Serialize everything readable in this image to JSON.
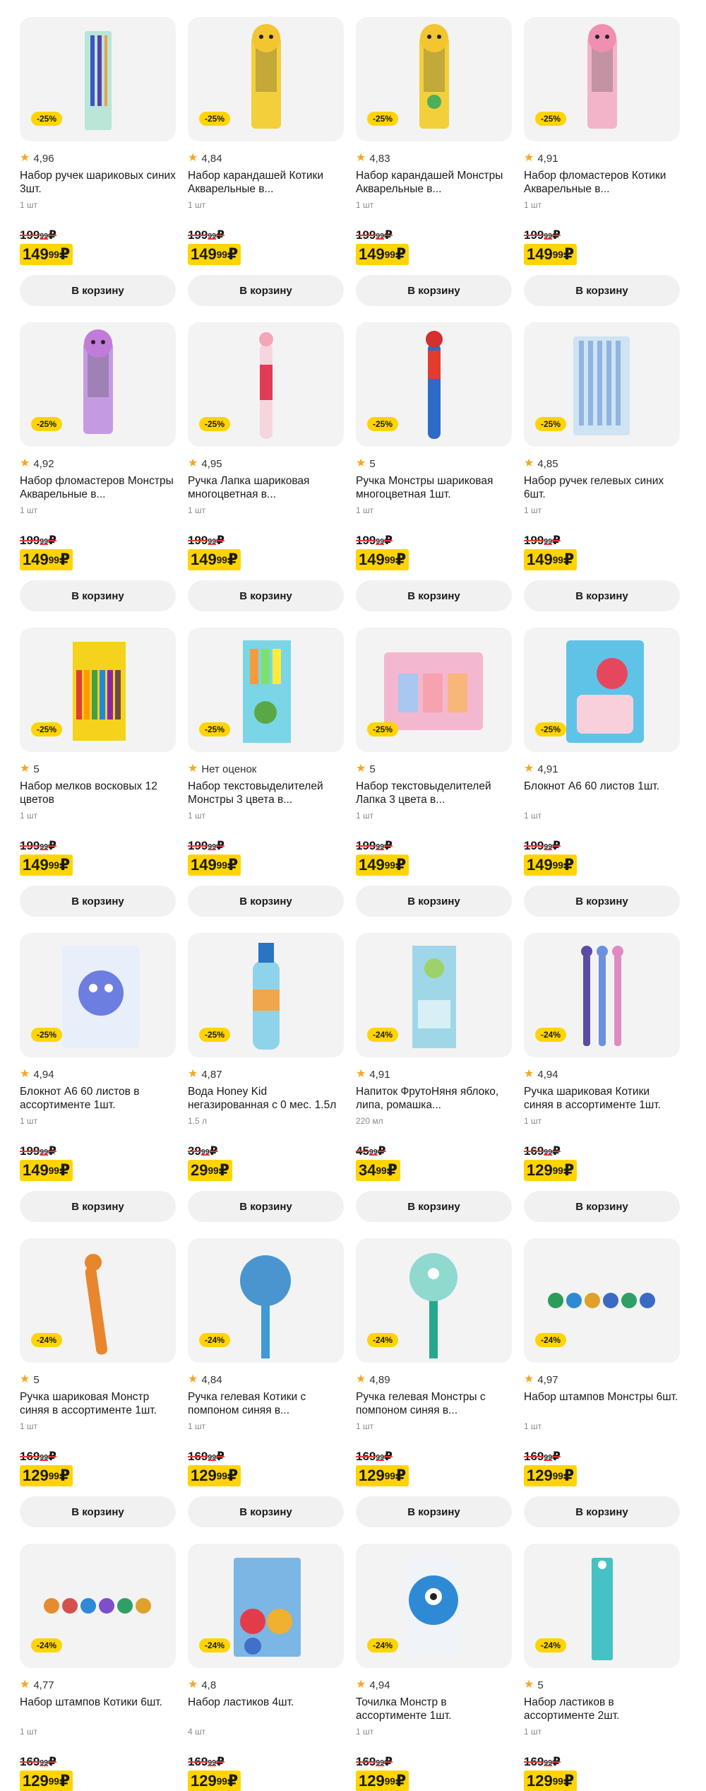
{
  "cart_button_label": "В корзину",
  "colors": {
    "accent": "#ffd400",
    "card_bg": "#f3f3f3",
    "star": "#f5a623",
    "strike": "#e53935"
  },
  "products": [
    {
      "discount": "-25%",
      "rating": "4,96",
      "title": "Набор ручек шариковых синих 3шт.",
      "unit": "1 шт",
      "old_price": "199",
      "old_kop": "99",
      "new_price": "149",
      "new_kop": "99",
      "currency": "₽",
      "image": "pens-blue-pack"
    },
    {
      "discount": "-25%",
      "rating": "4,84",
      "title": "Набор карандашей Котики Акварельные в...",
      "unit": "1 шт",
      "old_price": "199",
      "old_kop": "99",
      "new_price": "149",
      "new_kop": "99",
      "currency": "₽",
      "image": "pencils-cat-tube-yellow"
    },
    {
      "discount": "-25%",
      "rating": "4,83",
      "title": "Набор карандашей Монстры Акварельные в...",
      "unit": "1 шт",
      "old_price": "199",
      "old_kop": "99",
      "new_price": "149",
      "new_kop": "99",
      "currency": "₽",
      "image": "pencils-monster-tube-yellow"
    },
    {
      "discount": "-25%",
      "rating": "4,91",
      "title": "Набор фломастеров Котики Акварельные в...",
      "unit": "1 шт",
      "old_price": "199",
      "old_kop": "99",
      "new_price": "149",
      "new_kop": "99",
      "currency": "₽",
      "image": "markers-cat-tube-pink"
    },
    {
      "discount": "-25%",
      "rating": "4,92",
      "title": "Набор фломастеров Монстры Акварельные в...",
      "unit": "1 шт",
      "old_price": "199",
      "old_kop": "99",
      "new_price": "149",
      "new_kop": "99",
      "currency": "₽",
      "image": "markers-monster-tube-purple"
    },
    {
      "discount": "-25%",
      "rating": "4,95",
      "title": "Ручка Лапка шариковая многоцветная в...",
      "unit": "1 шт",
      "old_price": "199",
      "old_kop": "99",
      "new_price": "149",
      "new_kop": "99",
      "currency": "₽",
      "image": "pen-paw-multicolor"
    },
    {
      "discount": "-25%",
      "rating": "5",
      "title": "Ручка Монстры шариковая многоцветная 1шт.",
      "unit": "1 шт",
      "old_price": "199",
      "old_kop": "99",
      "new_price": "149",
      "new_kop": "99",
      "currency": "₽",
      "image": "pen-monster-multicolor"
    },
    {
      "discount": "-25%",
      "rating": "4,85",
      "title": "Набор ручек гелевых синих 6шт.",
      "unit": "1 шт",
      "old_price": "199",
      "old_kop": "99",
      "new_price": "149",
      "new_kop": "99",
      "currency": "₽",
      "image": "gel-pens-blue-pack"
    },
    {
      "discount": "-25%",
      "rating": "5",
      "title": "Набор мелков восковых 12 цветов",
      "unit": "1 шт",
      "old_price": "199",
      "old_kop": "99",
      "new_price": "149",
      "new_kop": "99",
      "currency": "₽",
      "image": "wax-crayons-box"
    },
    {
      "discount": "-25%",
      "rating": "Нет оценок",
      "title": "Набор текстовыделителей Монстры 3 цвета в...",
      "unit": "1 шт",
      "old_price": "199",
      "old_kop": "99",
      "new_price": "149",
      "new_kop": "99",
      "currency": "₽",
      "image": "highlighters-monster-box"
    },
    {
      "discount": "-25%",
      "rating": "5",
      "title": "Набор текстовыделителей Лапка 3 цвета в...",
      "unit": "1 шт",
      "old_price": "199",
      "old_kop": "99",
      "new_price": "149",
      "new_kop": "99",
      "currency": "₽",
      "image": "highlighters-paw-box"
    },
    {
      "discount": "-25%",
      "rating": "4,91",
      "title": "Блокнот А6 60 листов 1шт.",
      "unit": "1 шт",
      "old_price": "199",
      "old_kop": "99",
      "new_price": "149",
      "new_kop": "99",
      "currency": "₽",
      "image": "notebook-strawberry"
    },
    {
      "discount": "-25%",
      "rating": "4,94",
      "title": "Блокнот А6 60 листов в ассортименте 1шт.",
      "unit": "1 шт",
      "old_price": "199",
      "old_kop": "99",
      "new_price": "149",
      "new_kop": "99",
      "currency": "₽",
      "image": "notebook-monster"
    },
    {
      "discount": "-25%",
      "rating": "4,87",
      "title": "Вода Honey Kid негазированная с 0 мес. 1.5л",
      "unit": "1.5 л",
      "old_price": "39",
      "old_kop": "99",
      "new_price": "29",
      "new_kop": "99",
      "currency": "₽",
      "image": "water-bottle"
    },
    {
      "discount": "-24%",
      "rating": "4,91",
      "title": "Напиток ФрутоНяня яблоко, липа, ромашка...",
      "unit": "220 мл",
      "old_price": "45",
      "old_kop": "99",
      "new_price": "34",
      "new_kop": "99",
      "currency": "₽",
      "image": "juice-carton"
    },
    {
      "discount": "-24%",
      "rating": "4,94",
      "title": "Ручка шариковая Котики синяя в ассортименте 1шт.",
      "unit": "1 шт",
      "old_price": "169",
      "old_kop": "99",
      "new_price": "129",
      "new_kop": "99",
      "currency": "₽",
      "image": "pens-cat-paws"
    },
    {
      "discount": "-24%",
      "rating": "5",
      "title": "Ручка шариковая Монстр синяя в ассортименте 1шт.",
      "unit": "1 шт",
      "old_price": "169",
      "old_kop": "99",
      "new_price": "129",
      "new_kop": "99",
      "currency": "₽",
      "image": "pen-monster-orange"
    },
    {
      "discount": "-24%",
      "rating": "4,84",
      "title": "Ручка гелевая Котики с помпоном синяя в...",
      "unit": "1 шт",
      "old_price": "169",
      "old_kop": "99",
      "new_price": "129",
      "new_kop": "99",
      "currency": "₽",
      "image": "pen-cat-pompom-blue"
    },
    {
      "discount": "-24%",
      "rating": "4,89",
      "title": "Ручка гелевая Монстры с помпоном синяя в...",
      "unit": "1 шт",
      "old_price": "169",
      "old_kop": "99",
      "new_price": "129",
      "new_kop": "99",
      "currency": "₽",
      "image": "pen-monster-pompom"
    },
    {
      "discount": "-24%",
      "rating": "4,97",
      "title": "Набор штампов Монстры 6шт.",
      "unit": "1 шт",
      "old_price": "169",
      "old_kop": "99",
      "new_price": "129",
      "new_kop": "99",
      "currency": "₽",
      "image": "stamps-monster"
    },
    {
      "discount": "-24%",
      "rating": "4,77",
      "title": "Набор штампов Котики 6шт.",
      "unit": "1 шт",
      "old_price": "169",
      "old_kop": "99",
      "new_price": "129",
      "new_kop": "99",
      "currency": "₽",
      "image": "stamps-cat"
    },
    {
      "discount": "-24%",
      "rating": "4,8",
      "title": "Набор ластиков 4шт.",
      "unit": "4 шт",
      "old_price": "169",
      "old_kop": "99",
      "new_price": "129",
      "new_kop": "99",
      "currency": "₽",
      "image": "erasers-set"
    },
    {
      "discount": "-24%",
      "rating": "4,94",
      "title": "Точилка Монстр в ассортименте 1шт.",
      "unit": "1 шт",
      "old_price": "169",
      "old_kop": "99",
      "new_price": "129",
      "new_kop": "99",
      "currency": "₽",
      "image": "sharpener-monster"
    },
    {
      "discount": "-24%",
      "rating": "5",
      "title": "Набор ластиков в ассортименте 2шт.",
      "unit": "1 шт",
      "old_price": "169",
      "old_kop": "99",
      "new_price": "129",
      "new_kop": "99",
      "currency": "₽",
      "image": "erasers-pack-teal"
    }
  ]
}
